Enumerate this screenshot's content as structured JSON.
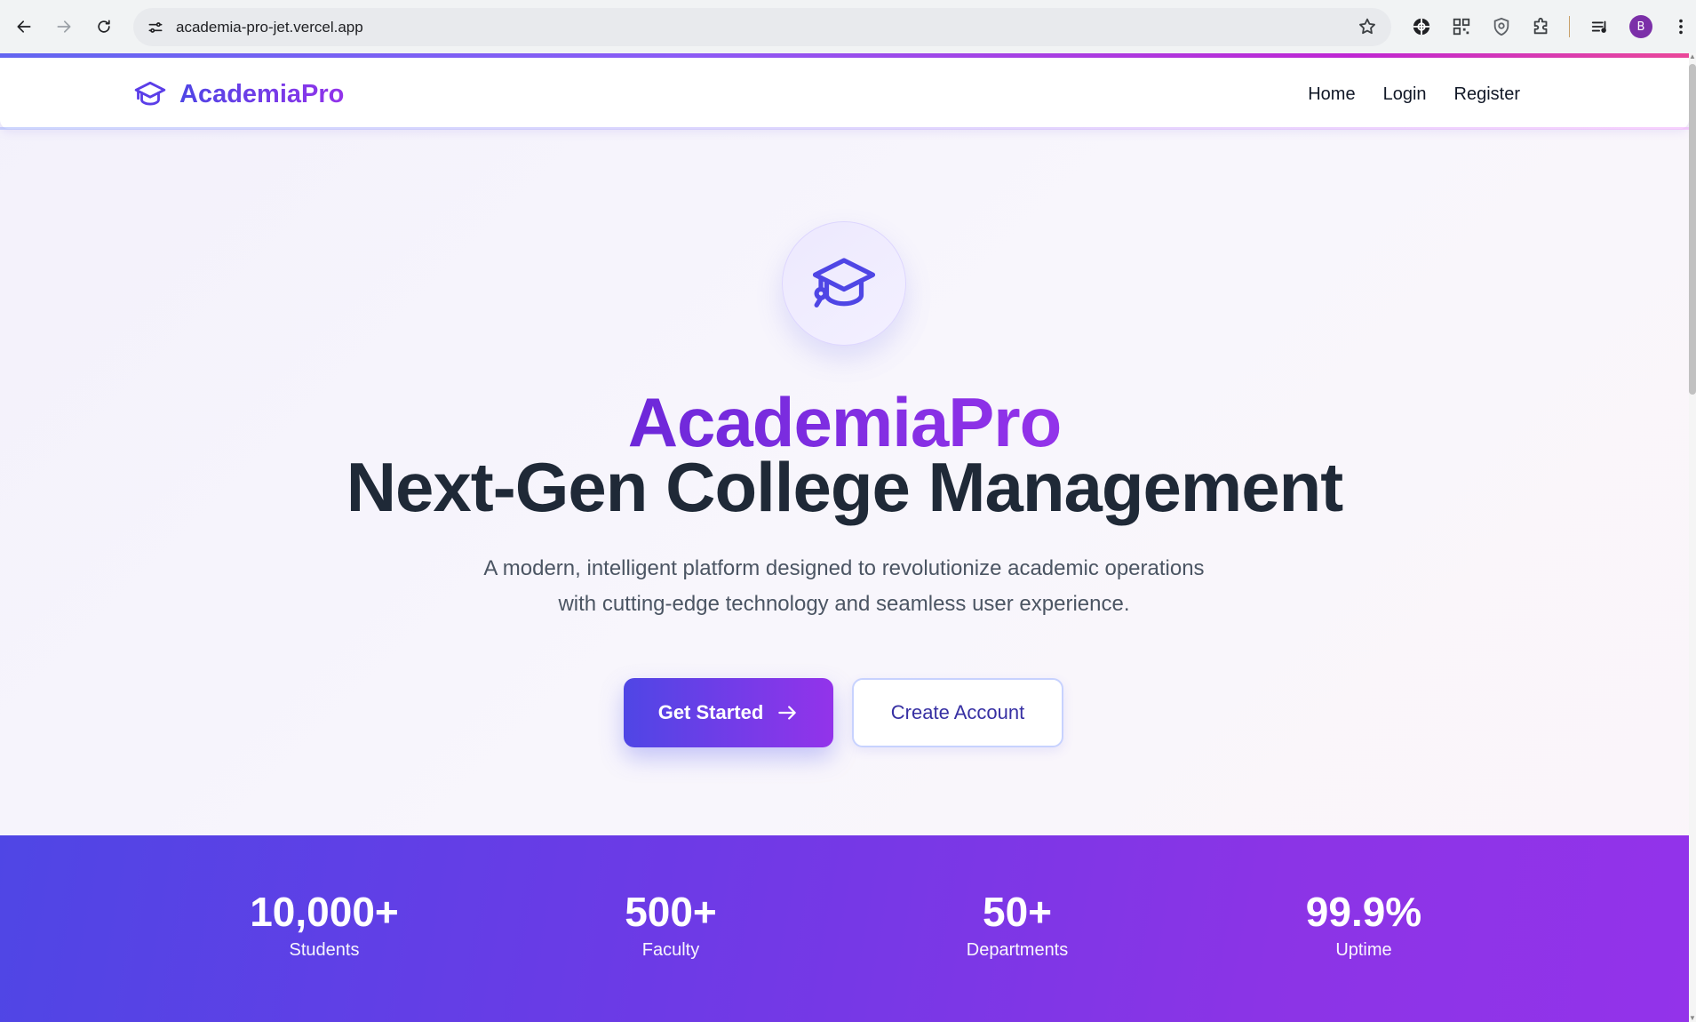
{
  "browser": {
    "url": "academia-pro-jet.vercel.app",
    "profile_initial": "B",
    "icons": [
      "back-icon",
      "forward-icon",
      "reload-icon",
      "site-info-icon",
      "bookmark-star-icon",
      "extension-globe-icon",
      "extension-qr-icon",
      "extension-shield-icon",
      "extensions-puzzle-icon",
      "media-queue-icon",
      "more-menu-icon"
    ]
  },
  "header": {
    "brand": "AcademiaPro",
    "nav": [
      {
        "label": "Home"
      },
      {
        "label": "Login"
      },
      {
        "label": "Register"
      }
    ]
  },
  "hero": {
    "brand_line": "AcademiaPro",
    "title": "Next-Gen College Management",
    "subtitle": "A modern, intelligent platform designed to revolutionize academic operations with cutting-edge technology and seamless user experience.",
    "primary_cta": "Get Started",
    "secondary_cta": "Create Account",
    "icon": "graduation-cap-icon"
  },
  "stats": [
    {
      "value": "10,000+",
      "label": "Students"
    },
    {
      "value": "500+",
      "label": "Faculty"
    },
    {
      "value": "50+",
      "label": "Departments"
    },
    {
      "value": "99.9%",
      "label": "Uptime"
    }
  ],
  "colors": {
    "accent_indigo": "#4f46e5",
    "accent_purple": "#9333ea",
    "heading_dark": "#1f2937",
    "body_text": "#4b5563"
  }
}
